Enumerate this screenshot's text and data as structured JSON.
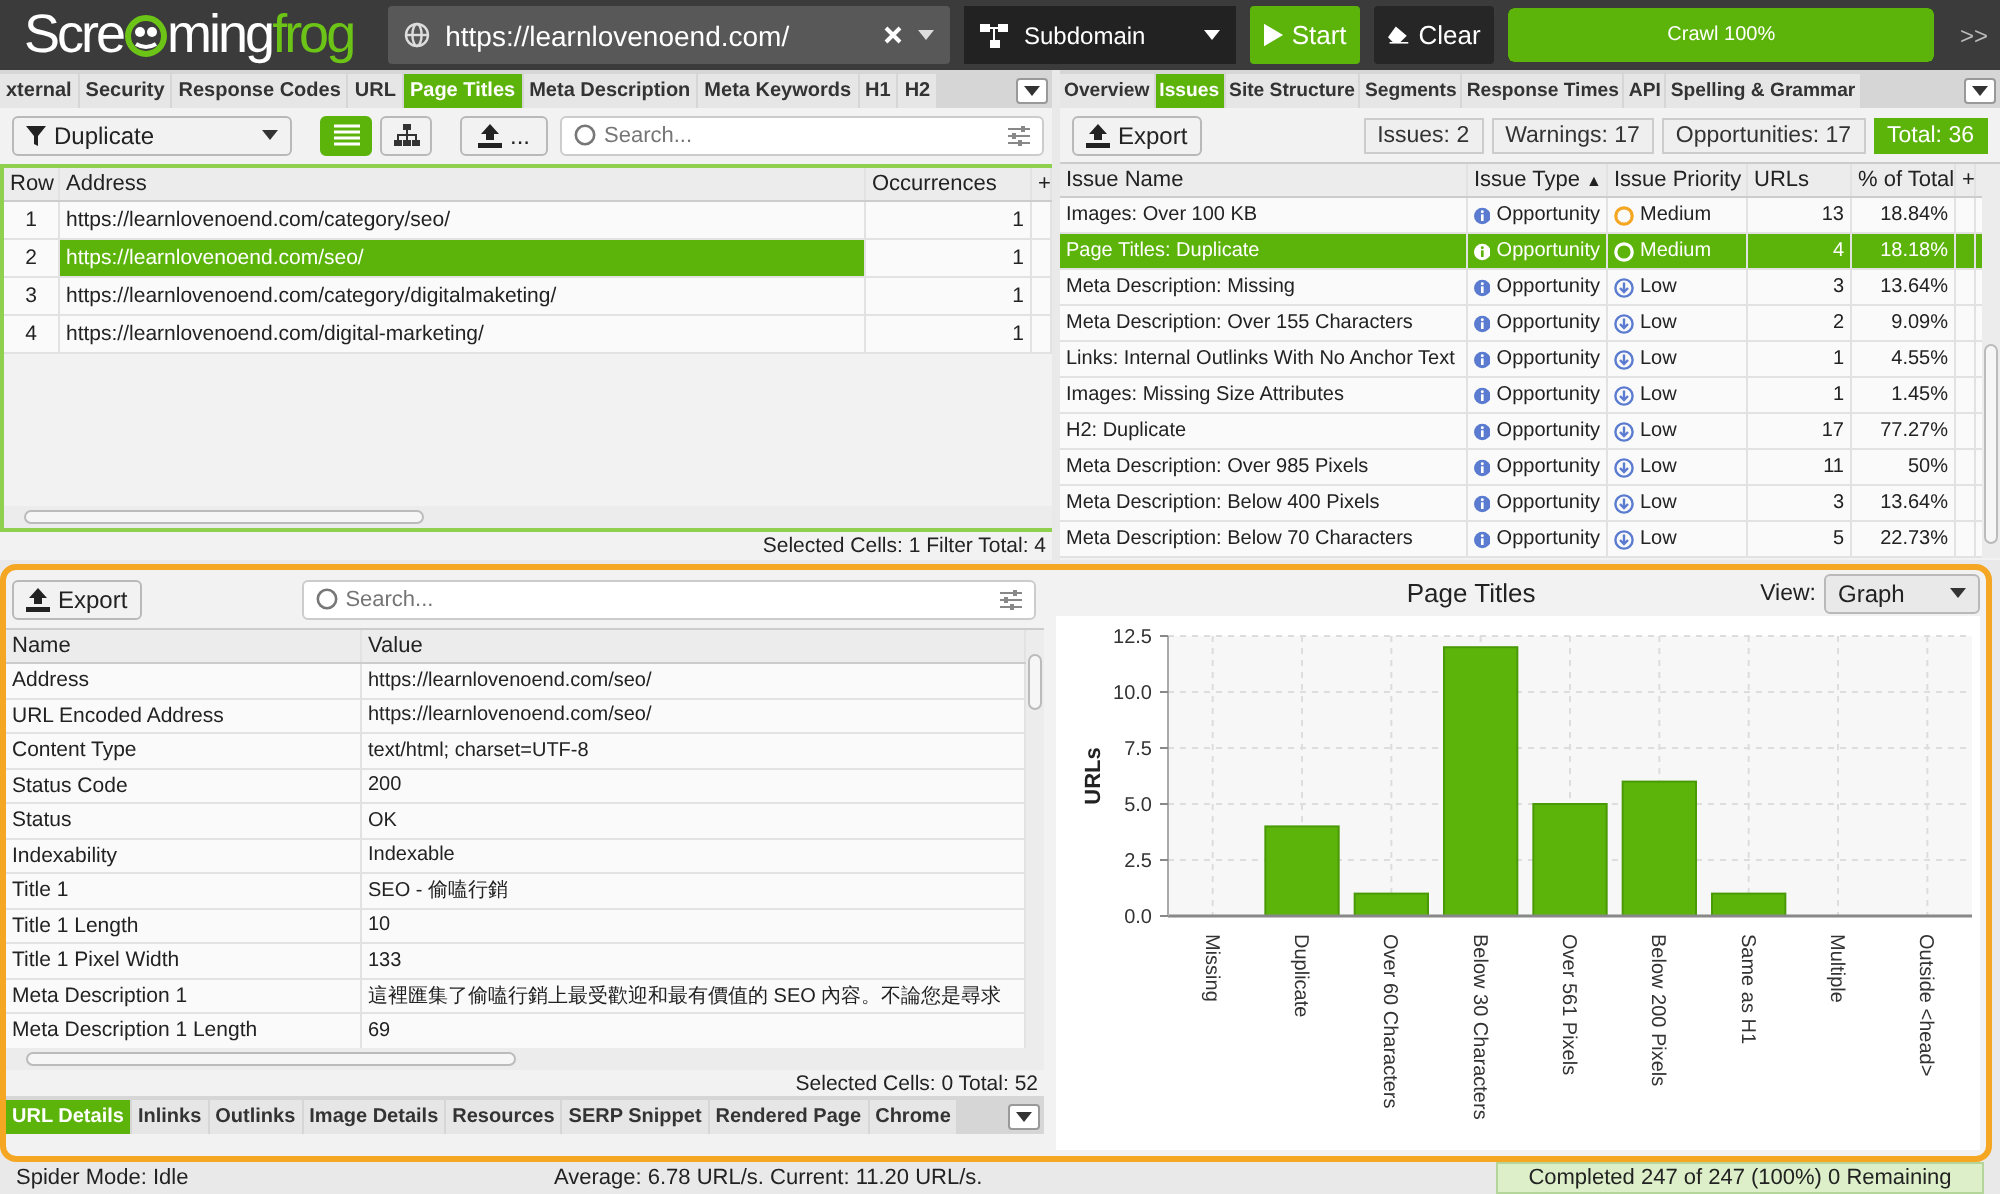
{
  "toolbar": {
    "logo": [
      {
        "text": "Scre",
        "color": "#ffffff"
      },
      {
        "text": "ming",
        "color": "#ffffff"
      },
      {
        "text": "frog",
        "color": "#6cc417"
      }
    ],
    "url": "https://learnlovenoend.com/",
    "mode": "Subdomain",
    "start": "Start",
    "clear": "Clear",
    "progress": {
      "label": "Crawl 100%",
      "level": 1
    },
    "more": ">>"
  },
  "left_pane": {
    "tabs": [
      {
        "label": "xternal",
        "selected": false
      },
      {
        "label": "Security",
        "selected": false
      },
      {
        "label": "Response Codes",
        "selected": false
      },
      {
        "label": "URL",
        "selected": false
      },
      {
        "label": "Page Titles",
        "selected": true
      },
      {
        "label": "Meta Description",
        "selected": false
      },
      {
        "label": "Meta Keywords",
        "selected": false
      },
      {
        "label": "H1",
        "selected": false
      },
      {
        "label": "H2",
        "selected": false
      }
    ],
    "filter": "Duplicate",
    "views": [
      {
        "kind": "list",
        "selected": true
      },
      {
        "kind": "tree",
        "selected": false
      }
    ],
    "export_label": "...",
    "search": {
      "placeholder": "Search..."
    },
    "table": {
      "columns": [
        "Row",
        "Address",
        "Occurrences",
        "+"
      ],
      "rows": [
        {
          "cells": [
            "1",
            "https://learnlovenoend.com/category/seo/",
            "1"
          ],
          "selected": false
        },
        {
          "cells": [
            "2",
            "https://learnlovenoend.com/seo/",
            "1"
          ],
          "selected": true
        },
        {
          "cells": [
            "3",
            "https://learnlovenoend.com/category/digitalmaketing/",
            "1"
          ],
          "selected": false
        },
        {
          "cells": [
            "4",
            "https://learnlovenoend.com/digital-marketing/",
            "1"
          ],
          "selected": false
        }
      ]
    },
    "status": "Selected Cells: 1 Filter Total: 4"
  },
  "right_pane": {
    "tabs": [
      {
        "label": "Overview",
        "selected": false
      },
      {
        "label": "Issues",
        "selected": true
      },
      {
        "label": "Site Structure",
        "selected": false
      },
      {
        "label": "Segments",
        "selected": false
      },
      {
        "label": "Response Times",
        "selected": false
      },
      {
        "label": "API",
        "selected": false
      },
      {
        "label": "Spelling & Grammar",
        "selected": false
      }
    ],
    "export": "Export",
    "counts": [
      {
        "label": "Issues: 2",
        "selected": false
      },
      {
        "label": "Warnings: 17",
        "selected": false
      },
      {
        "label": "Opportunities: 17",
        "selected": false
      },
      {
        "label": "Total: 36",
        "selected": true
      }
    ],
    "table": {
      "columns": [
        "Issue Name",
        "Issue Type",
        "Issue Priority",
        "URLs",
        "% of Total",
        "+"
      ],
      "sort_mark": "▲",
      "rows": [
        {
          "name": "Images: Over 100 KB",
          "type": "Opportunity",
          "priority": "Medium",
          "kind": "medium",
          "urls": "13",
          "percent": "18.84%",
          "selected": false
        },
        {
          "name": "Page Titles: Duplicate",
          "type": "Opportunity",
          "priority": "Medium",
          "kind": "medium",
          "urls": "4",
          "percent": "18.18%",
          "selected": true
        },
        {
          "name": "Meta Description: Missing",
          "type": "Opportunity",
          "priority": "Low",
          "kind": "low",
          "urls": "3",
          "percent": "13.64%",
          "selected": false
        },
        {
          "name": "Meta Description: Over 155 Characters",
          "type": "Opportunity",
          "priority": "Low",
          "kind": "low",
          "urls": "2",
          "percent": "9.09%",
          "selected": false
        },
        {
          "name": "Links: Internal Outlinks With No Anchor Text",
          "type": "Opportunity",
          "priority": "Low",
          "kind": "low",
          "urls": "1",
          "percent": "4.55%",
          "selected": false
        },
        {
          "name": "Images: Missing Size Attributes",
          "type": "Opportunity",
          "priority": "Low",
          "kind": "low",
          "urls": "1",
          "percent": "1.45%",
          "selected": false
        },
        {
          "name": "H2: Duplicate",
          "type": "Opportunity",
          "priority": "Low",
          "kind": "low",
          "urls": "17",
          "percent": "77.27%",
          "selected": false
        },
        {
          "name": "Meta Description: Over 985 Pixels",
          "type": "Opportunity",
          "priority": "Low",
          "kind": "low",
          "urls": "11",
          "percent": "50%",
          "selected": false
        },
        {
          "name": "Meta Description: Below 400 Pixels",
          "type": "Opportunity",
          "priority": "Low",
          "kind": "low",
          "urls": "3",
          "percent": "13.64%",
          "selected": false
        },
        {
          "name": "Meta Description: Below 70 Characters",
          "type": "Opportunity",
          "priority": "Low",
          "kind": "low",
          "urls": "5",
          "percent": "22.73%",
          "selected": false
        }
      ]
    }
  },
  "detail_pane": {
    "export": "Export",
    "search": {
      "placeholder": "Search..."
    },
    "table": {
      "columns": [
        "Name",
        "Value"
      ],
      "rows": [
        [
          "Address",
          "https://learnlovenoend.com/seo/"
        ],
        [
          "URL Encoded Address",
          "https://learnlovenoend.com/seo/"
        ],
        [
          "Content Type",
          "text/html; charset=UTF-8"
        ],
        [
          "Status Code",
          "200"
        ],
        [
          "Status",
          "OK"
        ],
        [
          "Indexability",
          "Indexable"
        ],
        [
          "Title 1",
          "SEO - 偷嗑行銷"
        ],
        [
          "Title 1 Length",
          "10"
        ],
        [
          "Title 1 Pixel Width",
          "133"
        ],
        [
          "Meta Description 1",
          "這裡匯集了偷嗑行銷上最受歡迎和最有價值的 SEO 內容。不論您是尋求"
        ],
        [
          "Meta Description 1 Length",
          "69"
        ]
      ]
    },
    "status": "Selected Cells: 0 Total: 52",
    "tabs": [
      {
        "label": "URL Details",
        "selected": true
      },
      {
        "label": "Inlinks",
        "selected": false
      },
      {
        "label": "Outlinks",
        "selected": false
      },
      {
        "label": "Image Details",
        "selected": false
      },
      {
        "label": "Resources",
        "selected": false
      },
      {
        "label": "SERP Snippet",
        "selected": false
      },
      {
        "label": "Rendered Page",
        "selected": false
      },
      {
        "label": "Chrome",
        "selected": false
      }
    ]
  },
  "graph_pane": {
    "title": "Page Titles",
    "view_label": "View:",
    "view": "Graph",
    "chart_data": {
      "type": "bar",
      "ylabel": "URLs",
      "grid": true,
      "categories": [
        "Missing",
        "Duplicate",
        "Over 60 Characters",
        "Below 30 Characters",
        "Over 561 Pixels",
        "Below 200 Pixels",
        "Same as H1",
        "Multiple",
        "Outside <head>"
      ],
      "values": [
        0,
        4,
        1,
        12,
        5,
        6,
        1,
        0,
        0
      ],
      "ylim": [
        0,
        12.5
      ],
      "yticks": [
        {
          "value": 0,
          "label": "0.0"
        },
        {
          "value": 2.5,
          "label": "2.5"
        },
        {
          "value": 5,
          "label": "5.0"
        },
        {
          "value": 7.5,
          "label": "7.5"
        },
        {
          "value": 10,
          "label": "10.0"
        },
        {
          "value": 12.5,
          "label": "12.5"
        }
      ]
    }
  },
  "status_bar": {
    "mode": "Spider Mode: Idle",
    "speed": "Average: 6.78 URL/s. Current: 11.20 URL/s.",
    "progress": "Completed 247 of 247 (100%) 0 Remaining"
  }
}
